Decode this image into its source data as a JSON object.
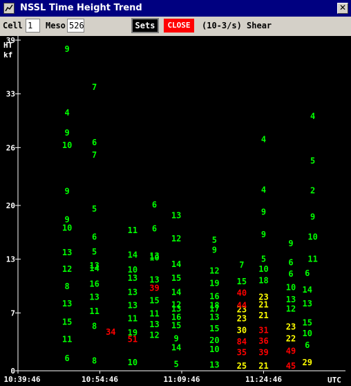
{
  "window": {
    "title": "NSSL Time Height Trend",
    "close_glyph": "✕"
  },
  "toolbar": {
    "cell_label": "Cell",
    "cell_value": "1",
    "meso_label": "Meso",
    "meso_value": "526",
    "sets_label": "Sets",
    "close_label": "CLOSE",
    "field_label": "(10-3/s) Shear"
  },
  "colors": {
    "background": "#000000",
    "axis": "#ffffff",
    "low": "#00ff00",
    "medium": "#ffff00",
    "high": "#ff0000",
    "title_bar": "#000080",
    "close_button": "#ff0000"
  },
  "chart_data": {
    "type": "scatter",
    "title": "",
    "ylabel": "HT kf",
    "ylim": [
      0,
      39
    ],
    "y_ticks": [
      "0",
      "7",
      "13",
      "20",
      "26",
      "33",
      "39"
    ],
    "y_tick_values": [
      0,
      7,
      13.5,
      20,
      27,
      33.5,
      40
    ],
    "xlim": [
      "10:39:46",
      "11:39:46"
    ],
    "x_ticks": [
      "10:39:46",
      "10:54:46",
      "11:09:46",
      "11:24:46"
    ],
    "x_unit": "UTC",
    "series": [
      {
        "time": "10:48:46",
        "points": [
          {
            "h": 1.5,
            "v": "6"
          },
          {
            "h": 3.8,
            "v": "11"
          },
          {
            "h": 5.9,
            "v": "15"
          },
          {
            "h": 8.1,
            "v": "13"
          },
          {
            "h": 10.2,
            "v": "8"
          },
          {
            "h": 12.3,
            "v": "12"
          },
          {
            "h": 14.3,
            "v": "13"
          },
          {
            "h": 17.3,
            "v": "10"
          },
          {
            "h": 18.3,
            "v": "9"
          },
          {
            "h": 21.7,
            "v": "9"
          },
          {
            "h": 27.3,
            "v": "10"
          },
          {
            "h": 28.8,
            "v": "9"
          },
          {
            "h": 31.2,
            "v": "4"
          },
          {
            "h": 38.9,
            "v": "9"
          }
        ]
      },
      {
        "time": "10:53:46",
        "points": [
          {
            "h": 1.2,
            "v": "8"
          },
          {
            "h": 5.4,
            "v": "8"
          },
          {
            "h": 7.2,
            "v": "11"
          },
          {
            "h": 8.9,
            "v": "13"
          },
          {
            "h": 10.5,
            "v": "16"
          },
          {
            "h": 12.4,
            "v": "14"
          },
          {
            "h": 12.7,
            "v": "13"
          },
          {
            "h": 14.4,
            "v": "5"
          },
          {
            "h": 16.2,
            "v": "6"
          },
          {
            "h": 19.6,
            "v": "5"
          },
          {
            "h": 26.1,
            "v": "7"
          },
          {
            "h": 27.6,
            "v": "6"
          },
          {
            "h": 34.3,
            "v": "7"
          }
        ]
      },
      {
        "time": "10:56:46",
        "points": [
          {
            "h": 4.7,
            "v": "34",
            "c": "high"
          }
        ]
      },
      {
        "time": "11:00:46",
        "points": [
          {
            "h": 1.0,
            "v": "10"
          },
          {
            "h": 3.8,
            "v": "51",
            "c": "high"
          },
          {
            "h": 4.6,
            "v": "19"
          },
          {
            "h": 6.3,
            "v": "11"
          },
          {
            "h": 7.9,
            "v": "13"
          },
          {
            "h": 9.5,
            "v": "13"
          },
          {
            "h": 11.2,
            "v": "13"
          },
          {
            "h": 12.2,
            "v": "10"
          },
          {
            "h": 14.0,
            "v": "14"
          },
          {
            "h": 17.0,
            "v": "11"
          }
        ]
      },
      {
        "time": "11:04:46",
        "points": [
          {
            "h": 4.3,
            "v": "12"
          },
          {
            "h": 5.6,
            "v": "13"
          },
          {
            "h": 6.9,
            "v": "11"
          },
          {
            "h": 8.5,
            "v": "15"
          },
          {
            "h": 10.0,
            "v": "39",
            "c": "high"
          },
          {
            "h": 11.0,
            "v": "13"
          },
          {
            "h": 13.7,
            "v": "10"
          },
          {
            "h": 13.9,
            "v": "13"
          },
          {
            "h": 17.2,
            "v": "6"
          },
          {
            "h": 20.1,
            "v": "6"
          }
        ]
      },
      {
        "time": "11:08:46",
        "points": [
          {
            "h": 0.8,
            "v": "5"
          },
          {
            "h": 2.8,
            "v": "14"
          },
          {
            "h": 3.9,
            "v": "9"
          },
          {
            "h": 5.5,
            "v": "15"
          },
          {
            "h": 6.5,
            "v": "16"
          },
          {
            "h": 7.5,
            "v": "13"
          },
          {
            "h": 8.0,
            "v": "12"
          },
          {
            "h": 9.5,
            "v": "14"
          },
          {
            "h": 11.2,
            "v": "15"
          },
          {
            "h": 12.9,
            "v": "14"
          },
          {
            "h": 16.0,
            "v": "12"
          },
          {
            "h": 18.8,
            "v": "13"
          }
        ]
      },
      {
        "time": "11:15:46",
        "points": [
          {
            "h": 0.7,
            "v": "13"
          },
          {
            "h": 2.6,
            "v": "10"
          },
          {
            "h": 3.7,
            "v": "20"
          },
          {
            "h": 5.1,
            "v": "15"
          },
          {
            "h": 6.5,
            "v": "13"
          },
          {
            "h": 7.5,
            "v": "17"
          },
          {
            "h": 7.9,
            "v": "18"
          },
          {
            "h": 9.0,
            "v": "16"
          },
          {
            "h": 10.6,
            "v": "19"
          },
          {
            "h": 12.1,
            "v": "12"
          },
          {
            "h": 14.6,
            "v": "9"
          },
          {
            "h": 15.8,
            "v": "5"
          }
        ]
      },
      {
        "time": "11:20:46",
        "points": [
          {
            "h": 0.6,
            "v": "25",
            "c": "medium"
          },
          {
            "h": 2.2,
            "v": "35",
            "c": "high"
          },
          {
            "h": 3.5,
            "v": "84",
            "c": "high"
          },
          {
            "h": 4.9,
            "v": "30",
            "c": "medium"
          },
          {
            "h": 6.3,
            "v": "23",
            "c": "medium"
          },
          {
            "h": 7.4,
            "v": "23",
            "c": "medium"
          },
          {
            "h": 7.9,
            "v": "44",
            "c": "high"
          },
          {
            "h": 9.4,
            "v": "40",
            "c": "high"
          },
          {
            "h": 10.8,
            "v": "15"
          },
          {
            "h": 12.8,
            "v": "7"
          }
        ]
      },
      {
        "time": "11:24:46",
        "points": [
          {
            "h": 0.6,
            "v": "21",
            "c": "medium"
          },
          {
            "h": 2.2,
            "v": "39",
            "c": "high"
          },
          {
            "h": 3.6,
            "v": "36",
            "c": "high"
          },
          {
            "h": 4.9,
            "v": "31",
            "c": "high"
          },
          {
            "h": 6.7,
            "v": "21",
            "c": "medium"
          },
          {
            "h": 8.0,
            "v": "21",
            "c": "medium"
          },
          {
            "h": 8.9,
            "v": "23",
            "c": "medium"
          },
          {
            "h": 10.9,
            "v": "18"
          },
          {
            "h": 12.3,
            "v": "10"
          },
          {
            "h": 13.5,
            "v": "5"
          },
          {
            "h": 16.5,
            "v": "9"
          },
          {
            "h": 19.2,
            "v": "9"
          },
          {
            "h": 21.9,
            "v": "4"
          },
          {
            "h": 28.0,
            "v": "4"
          }
        ]
      },
      {
        "time": "11:29:46",
        "points": [
          {
            "h": 0.6,
            "v": "45",
            "c": "high"
          },
          {
            "h": 2.4,
            "v": "49",
            "c": "high"
          },
          {
            "h": 3.9,
            "v": "22",
            "c": "medium"
          },
          {
            "h": 5.3,
            "v": "23",
            "c": "medium"
          },
          {
            "h": 7.5,
            "v": "12"
          },
          {
            "h": 8.6,
            "v": "13"
          },
          {
            "h": 10.1,
            "v": "10"
          },
          {
            "h": 11.7,
            "v": "6"
          },
          {
            "h": 13.1,
            "v": "6"
          },
          {
            "h": 15.4,
            "v": "9"
          }
        ]
      },
      {
        "time": "11:32:46",
        "points": [
          {
            "h": 1.0,
            "v": "29",
            "c": "medium"
          },
          {
            "h": 3.1,
            "v": "6"
          },
          {
            "h": 4.5,
            "v": "10"
          },
          {
            "h": 5.8,
            "v": "15"
          },
          {
            "h": 8.1,
            "v": "13"
          },
          {
            "h": 9.8,
            "v": "14"
          },
          {
            "h": 11.8,
            "v": "6"
          }
        ]
      },
      {
        "time": "11:33:46",
        "points": [
          {
            "h": 13.5,
            "v": "11"
          },
          {
            "h": 16.2,
            "v": "10"
          },
          {
            "h": 18.6,
            "v": "9"
          },
          {
            "h": 21.8,
            "v": "2"
          },
          {
            "h": 25.4,
            "v": "5"
          },
          {
            "h": 30.8,
            "v": "4"
          }
        ]
      }
    ]
  }
}
